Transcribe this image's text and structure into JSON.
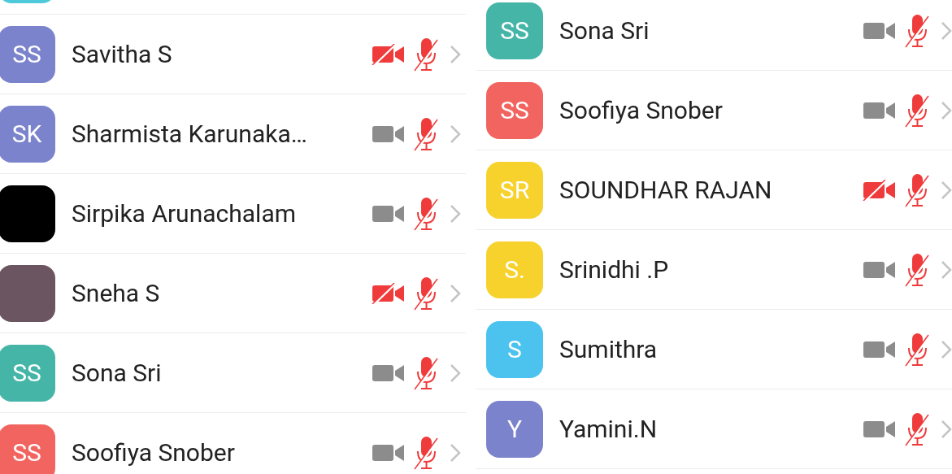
{
  "panels": [
    {
      "rows": [
        {
          "avatar": {
            "kind": "initials",
            "color": "#4dc9d9"
          }
        },
        {
          "name": "Savitha S",
          "avatar": {
            "kind": "initials",
            "initials": "SS",
            "color": "#7b83cc"
          },
          "video_off": true,
          "muted": true
        },
        {
          "name": "Sharmista Karunaka…",
          "avatar": {
            "kind": "initials",
            "initials": "SK",
            "color": "#7b83cc"
          },
          "video_off": false,
          "muted": true
        },
        {
          "name": "Sirpika Arunachalam",
          "avatar": {
            "kind": "blank",
            "color": "#000000"
          },
          "video_off": false,
          "muted": true
        },
        {
          "name": "Sneha S",
          "avatar": {
            "kind": "photo",
            "color": "#6b5560"
          },
          "video_off": true,
          "muted": true
        },
        {
          "name": "Sona Sri",
          "avatar": {
            "kind": "initials",
            "initials": "SS",
            "color": "#45b5a8"
          },
          "video_off": false,
          "muted": true
        },
        {
          "name": "Soofiya Snober",
          "avatar": {
            "kind": "initials",
            "initials": "SS",
            "color": "#f2645f"
          },
          "video_off": false,
          "muted": true
        }
      ]
    },
    {
      "rows": [
        {
          "name": "Sona Sri",
          "avatar": {
            "kind": "initials",
            "initials": "SS",
            "color": "#45b5a8"
          },
          "video_off": false,
          "muted": true
        },
        {
          "name": "Soofiya Snober",
          "avatar": {
            "kind": "initials",
            "initials": "SS",
            "color": "#f2645f"
          },
          "video_off": false,
          "muted": true
        },
        {
          "name": "SOUNDHAR RAJAN",
          "avatar": {
            "kind": "initials",
            "initials": "SR",
            "color": "#f7d22d"
          },
          "video_off": true,
          "muted": true
        },
        {
          "name": "Srinidhi .P",
          "avatar": {
            "kind": "initials",
            "initials": "S.",
            "color": "#f7d22d"
          },
          "video_off": false,
          "muted": true
        },
        {
          "name": "Sumithra",
          "avatar": {
            "kind": "initials",
            "initials": "S",
            "color": "#4cc3ef"
          },
          "video_off": false,
          "muted": true
        },
        {
          "name": "Yamini.N",
          "avatar": {
            "kind": "initials",
            "initials": "Y",
            "color": "#7b83cc"
          },
          "video_off": false,
          "muted": true
        }
      ]
    }
  ]
}
